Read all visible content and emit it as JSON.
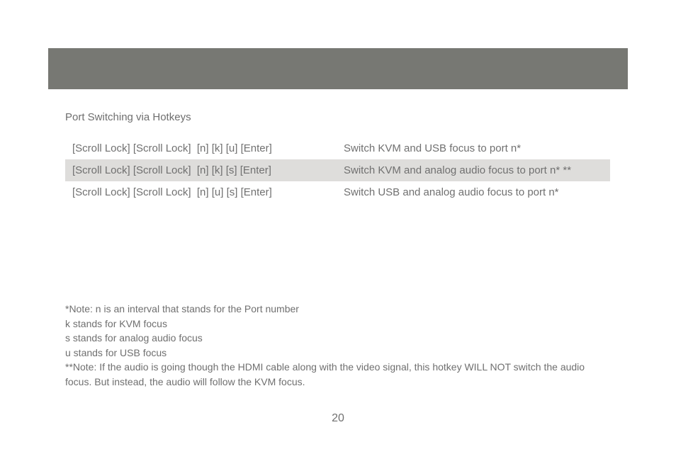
{
  "header": {
    "banner_color": "#777873"
  },
  "section_title": "Port Switching via Hotkeys",
  "hotkeys": [
    {
      "keys": "[Scroll Lock] [Scroll Lock]  [n] [k] [u] [Enter]",
      "description": "Switch KVM and USB focus to port n*"
    },
    {
      "keys": "[Scroll Lock] [Scroll Lock]  [n] [k] [s] [Enter]",
      "description": "Switch KVM and analog audio focus to port n* **"
    },
    {
      "keys": "[Scroll Lock] [Scroll Lock]  [n] [u] [s] [Enter]",
      "description": "Switch USB and analog audio focus to port n*"
    }
  ],
  "notes": [
    "*Note: n is an interval that stands for the Port number",
    "k stands for KVM focus",
    "s stands for analog audio focus",
    "u stands for USB focus",
    "**Note: If the audio is going though the HDMI cable along with the video signal, this hotkey WILL NOT switch the audio focus. But instead, the audio will follow the KVM focus."
  ],
  "page_number": "20"
}
